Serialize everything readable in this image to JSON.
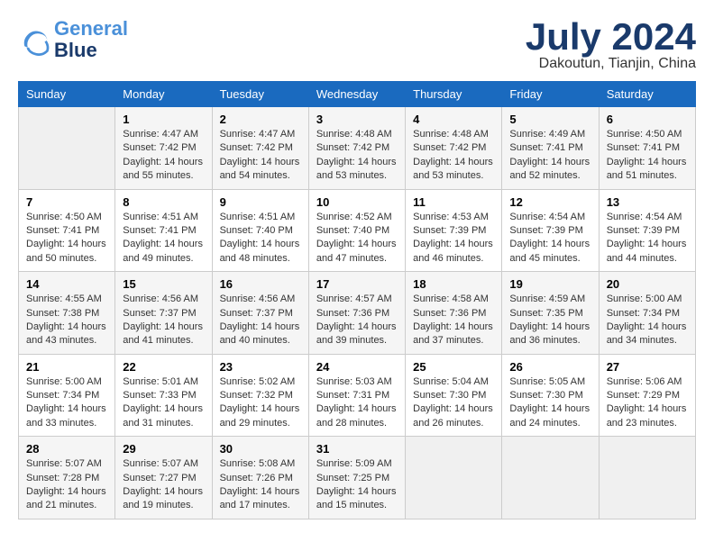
{
  "header": {
    "logo_line1": "General",
    "logo_line2": "Blue",
    "month": "July 2024",
    "location": "Dakoutun, Tianjin, China"
  },
  "days_of_week": [
    "Sunday",
    "Monday",
    "Tuesday",
    "Wednesday",
    "Thursday",
    "Friday",
    "Saturday"
  ],
  "weeks": [
    [
      {
        "day": "",
        "info": ""
      },
      {
        "day": "1",
        "info": "Sunrise: 4:47 AM\nSunset: 7:42 PM\nDaylight: 14 hours\nand 55 minutes."
      },
      {
        "day": "2",
        "info": "Sunrise: 4:47 AM\nSunset: 7:42 PM\nDaylight: 14 hours\nand 54 minutes."
      },
      {
        "day": "3",
        "info": "Sunrise: 4:48 AM\nSunset: 7:42 PM\nDaylight: 14 hours\nand 53 minutes."
      },
      {
        "day": "4",
        "info": "Sunrise: 4:48 AM\nSunset: 7:42 PM\nDaylight: 14 hours\nand 53 minutes."
      },
      {
        "day": "5",
        "info": "Sunrise: 4:49 AM\nSunset: 7:41 PM\nDaylight: 14 hours\nand 52 minutes."
      },
      {
        "day": "6",
        "info": "Sunrise: 4:50 AM\nSunset: 7:41 PM\nDaylight: 14 hours\nand 51 minutes."
      }
    ],
    [
      {
        "day": "7",
        "info": "Sunrise: 4:50 AM\nSunset: 7:41 PM\nDaylight: 14 hours\nand 50 minutes."
      },
      {
        "day": "8",
        "info": "Sunrise: 4:51 AM\nSunset: 7:41 PM\nDaylight: 14 hours\nand 49 minutes."
      },
      {
        "day": "9",
        "info": "Sunrise: 4:51 AM\nSunset: 7:40 PM\nDaylight: 14 hours\nand 48 minutes."
      },
      {
        "day": "10",
        "info": "Sunrise: 4:52 AM\nSunset: 7:40 PM\nDaylight: 14 hours\nand 47 minutes."
      },
      {
        "day": "11",
        "info": "Sunrise: 4:53 AM\nSunset: 7:39 PM\nDaylight: 14 hours\nand 46 minutes."
      },
      {
        "day": "12",
        "info": "Sunrise: 4:54 AM\nSunset: 7:39 PM\nDaylight: 14 hours\nand 45 minutes."
      },
      {
        "day": "13",
        "info": "Sunrise: 4:54 AM\nSunset: 7:39 PM\nDaylight: 14 hours\nand 44 minutes."
      }
    ],
    [
      {
        "day": "14",
        "info": "Sunrise: 4:55 AM\nSunset: 7:38 PM\nDaylight: 14 hours\nand 43 minutes."
      },
      {
        "day": "15",
        "info": "Sunrise: 4:56 AM\nSunset: 7:37 PM\nDaylight: 14 hours\nand 41 minutes."
      },
      {
        "day": "16",
        "info": "Sunrise: 4:56 AM\nSunset: 7:37 PM\nDaylight: 14 hours\nand 40 minutes."
      },
      {
        "day": "17",
        "info": "Sunrise: 4:57 AM\nSunset: 7:36 PM\nDaylight: 14 hours\nand 39 minutes."
      },
      {
        "day": "18",
        "info": "Sunrise: 4:58 AM\nSunset: 7:36 PM\nDaylight: 14 hours\nand 37 minutes."
      },
      {
        "day": "19",
        "info": "Sunrise: 4:59 AM\nSunset: 7:35 PM\nDaylight: 14 hours\nand 36 minutes."
      },
      {
        "day": "20",
        "info": "Sunrise: 5:00 AM\nSunset: 7:34 PM\nDaylight: 14 hours\nand 34 minutes."
      }
    ],
    [
      {
        "day": "21",
        "info": "Sunrise: 5:00 AM\nSunset: 7:34 PM\nDaylight: 14 hours\nand 33 minutes."
      },
      {
        "day": "22",
        "info": "Sunrise: 5:01 AM\nSunset: 7:33 PM\nDaylight: 14 hours\nand 31 minutes."
      },
      {
        "day": "23",
        "info": "Sunrise: 5:02 AM\nSunset: 7:32 PM\nDaylight: 14 hours\nand 29 minutes."
      },
      {
        "day": "24",
        "info": "Sunrise: 5:03 AM\nSunset: 7:31 PM\nDaylight: 14 hours\nand 28 minutes."
      },
      {
        "day": "25",
        "info": "Sunrise: 5:04 AM\nSunset: 7:30 PM\nDaylight: 14 hours\nand 26 minutes."
      },
      {
        "day": "26",
        "info": "Sunrise: 5:05 AM\nSunset: 7:30 PM\nDaylight: 14 hours\nand 24 minutes."
      },
      {
        "day": "27",
        "info": "Sunrise: 5:06 AM\nSunset: 7:29 PM\nDaylight: 14 hours\nand 23 minutes."
      }
    ],
    [
      {
        "day": "28",
        "info": "Sunrise: 5:07 AM\nSunset: 7:28 PM\nDaylight: 14 hours\nand 21 minutes."
      },
      {
        "day": "29",
        "info": "Sunrise: 5:07 AM\nSunset: 7:27 PM\nDaylight: 14 hours\nand 19 minutes."
      },
      {
        "day": "30",
        "info": "Sunrise: 5:08 AM\nSunset: 7:26 PM\nDaylight: 14 hours\nand 17 minutes."
      },
      {
        "day": "31",
        "info": "Sunrise: 5:09 AM\nSunset: 7:25 PM\nDaylight: 14 hours\nand 15 minutes."
      },
      {
        "day": "",
        "info": ""
      },
      {
        "day": "",
        "info": ""
      },
      {
        "day": "",
        "info": ""
      }
    ]
  ]
}
